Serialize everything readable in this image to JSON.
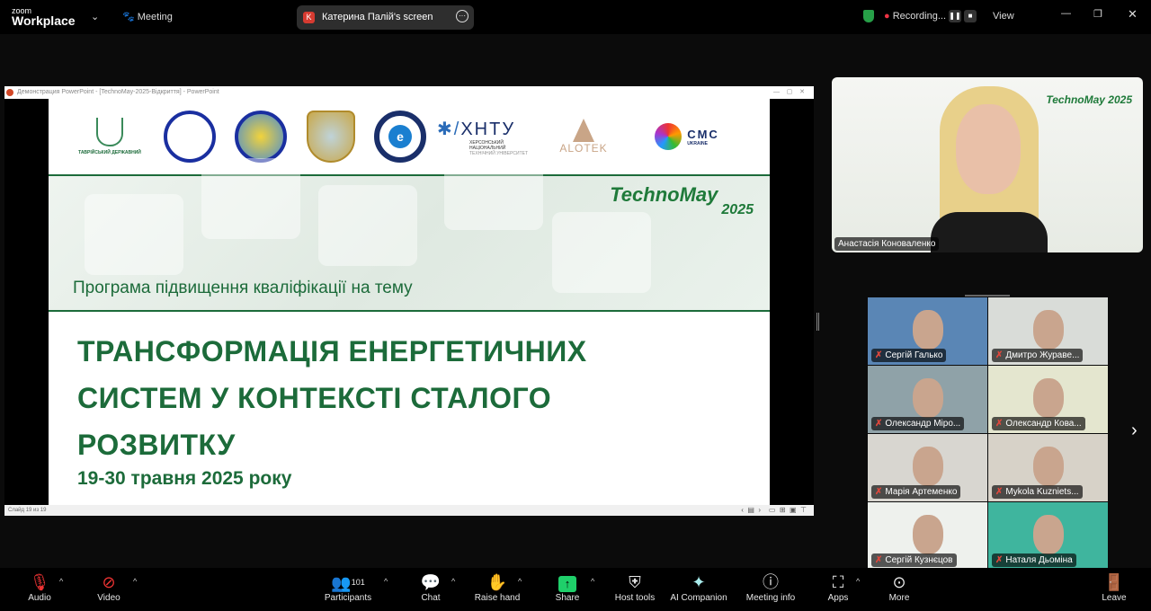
{
  "app": {
    "brand_small": "zoom",
    "brand": "Workplace",
    "meeting_label": "Meeting",
    "share_initial": "K",
    "share_label": "Катерина Палій's screen",
    "recording_label": "Recording...",
    "view_label": "View"
  },
  "shared_window": {
    "title": "Демонстрация PowerPoint - [TechnoMay-2025-Відкриття] - PowerPoint",
    "status": "Слайд 19 из 19"
  },
  "slide": {
    "logos": [
      {
        "name": "Таврійський державний агротехнологічний університет",
        "text": "ТАВРІЙСЬКИЙ ДЕРЖАВНИЙ"
      },
      {
        "name": "university-seal"
      },
      {
        "name": "institute-renewable-energy"
      },
      {
        "name": "shield-emblem"
      },
      {
        "name": "Інститут загальної енергетики НАН України",
        "text": "e"
      },
      {
        "name": "ХНТУ",
        "text": "ХНТУ",
        "sub": "ХЕРСОНСЬКИЙ НАЦІОНАЛЬНИЙ ТЕХНІЧНИЙ УНІВЕРСИТЕТ"
      },
      {
        "name": "ALOTEK",
        "text": "ALOTEK"
      },
      {
        "name": "CMC Ukraine",
        "text": "CMC",
        "sub": "UKRAINE"
      }
    ],
    "brand": "TechnoMay",
    "brand_year": "2025",
    "subtitle": "Програма підвищення кваліфікації на тему",
    "title_lines": [
      "ТРАНСФОРМАЦІЯ ЕНЕРГЕТИЧНИХ",
      "СИСТЕМ У КОНТЕКСТІ СТАЛОГО",
      "РОЗВИТКУ"
    ],
    "dates": "19-30 травня 2025 року",
    "accent": "#1c6b3a"
  },
  "speaker": {
    "name": "Анастасія Коноваленко"
  },
  "gallery": [
    {
      "name": "Сергій Галько",
      "bg": "#5a86b5"
    },
    {
      "name": "Дмитро Журавe...",
      "bg": "#d9dcd8"
    },
    {
      "name": "Олександр Міро...",
      "bg": "#8fa2a8"
    },
    {
      "name": "Олександр Кова...",
      "bg": "#e4e6cf"
    },
    {
      "name": "Марія Артеменко",
      "bg": "#d8d6d0"
    },
    {
      "name": "Mykola Kuzniets...",
      "bg": "#d7d2c8"
    },
    {
      "name": "Сергій Кузнєцов",
      "bg": "#eef1ed"
    },
    {
      "name": "Наталя Дьоміна",
      "bg": "#3fb59e"
    }
  ],
  "toolbar": {
    "audio": "Audio",
    "video": "Video",
    "participants": "Participants",
    "participants_count": "101",
    "chat": "Chat",
    "raise_hand": "Raise hand",
    "share": "Share",
    "host_tools": "Host tools",
    "ai_companion": "AI Companion",
    "meeting_info": "Meeting info",
    "apps": "Apps",
    "more": "More",
    "leave": "Leave"
  }
}
